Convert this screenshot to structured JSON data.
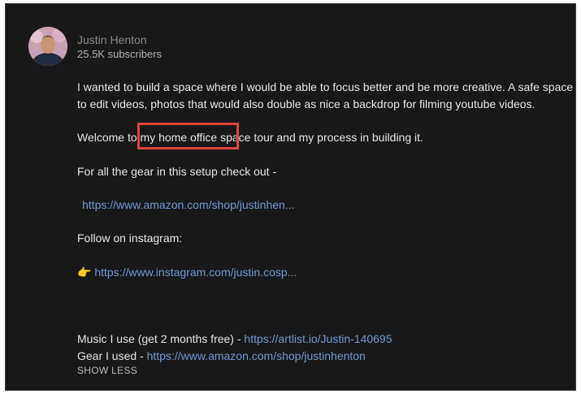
{
  "channel": {
    "name": "Justin Henton",
    "subscribers": "25.5K subscribers"
  },
  "description": {
    "paragraph1_line1": "I wanted to build a space where I would be able to  focus better and be more creative. A safe space",
    "paragraph1_line2": "to  edit videos, photos that would also double as nice a  backdrop for filming youtube videos.",
    "welcome_line": "Welcome to my home office space tour and my process in building it.",
    "gear_intro": "For all the gear in this setup check out -",
    "gear_link": "https://www.amazon.com/shop/justinhen...",
    "instagram_intro": "Follow on instagram:",
    "instagram_pointer": "👉",
    "instagram_link": "https://www.instagram.com/justin.cosp...",
    "music_label": "Music I use (get 2 months free) - ",
    "music_link": "https://artlist.io/Justin-140695",
    "gear_used_label": "Gear I used - ",
    "gear_used_link": "https://www.amazon.com/shop/justinhenton"
  },
  "actions": {
    "show_less": "SHOW LESS"
  },
  "colors": {
    "background": "#181818",
    "link": "#6f9ad6",
    "highlight": "#e0453a"
  },
  "annotation": {
    "highlighted_phrase": "my home office space"
  }
}
